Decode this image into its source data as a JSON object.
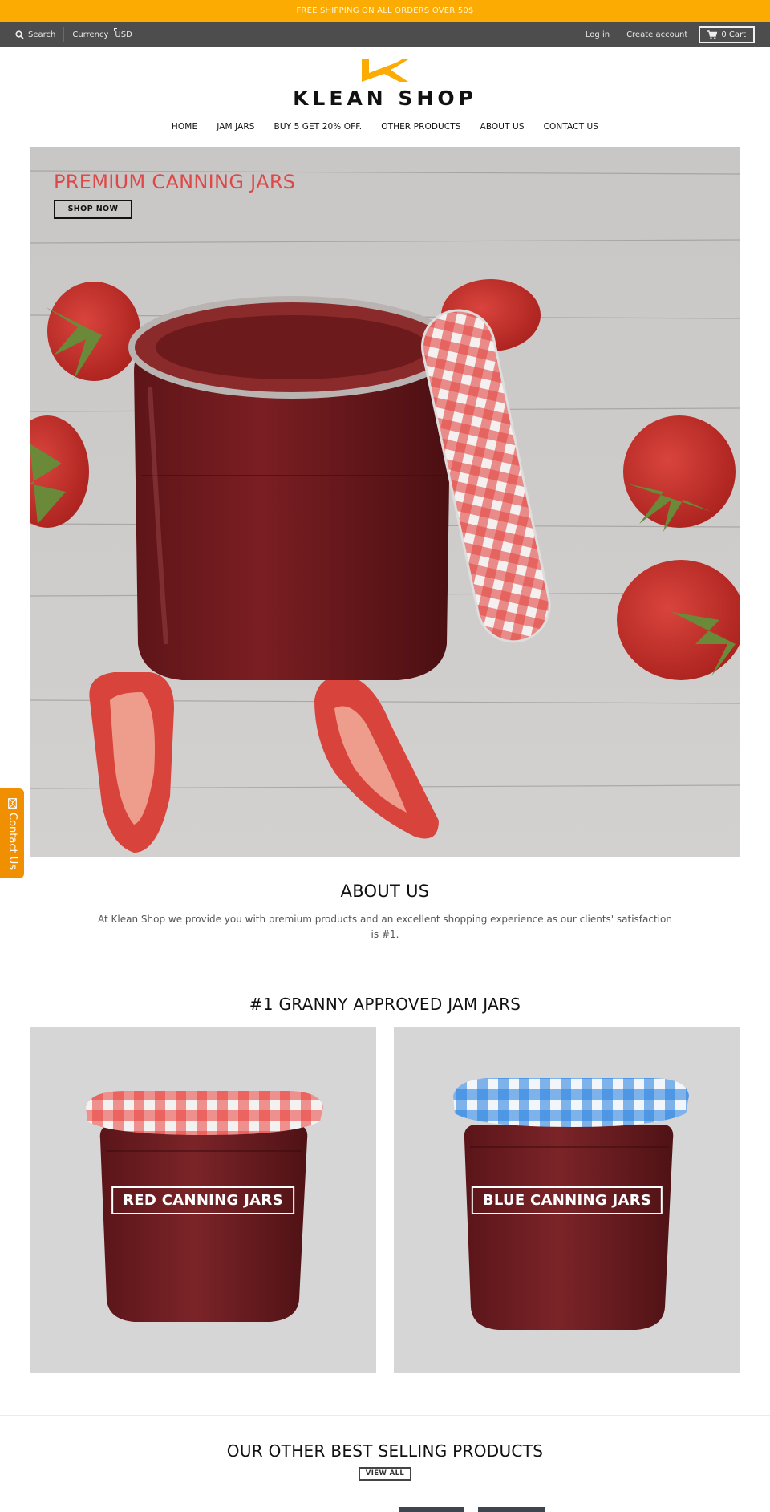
{
  "announcement": {
    "text": "FREE SHIPPING ON ALL ORDERS OVER 50$"
  },
  "topbar": {
    "search_label": "Search",
    "currency_label": "Currency",
    "currency_value": "USD",
    "login_label": "Log in",
    "create_account_label": "Create account",
    "cart_label": "0 Cart"
  },
  "header": {
    "logo_text": "KLEAN SHOP",
    "brand_color": "#fcab03"
  },
  "nav": {
    "items": [
      {
        "label": "HOME"
      },
      {
        "label": "JAM JARS"
      },
      {
        "label": "BUY 5 GET 20% OFF."
      },
      {
        "label": "OTHER PRODUCTS"
      },
      {
        "label": "ABOUT US"
      },
      {
        "label": "CONTACT US"
      }
    ]
  },
  "hero": {
    "title": "PREMIUM CANNING JARS",
    "title_color": "#de4848",
    "button_label": "SHOP NOW"
  },
  "contact_tab": {
    "label": "Contact Us"
  },
  "about": {
    "heading": "ABOUT US",
    "text": "At Klean Shop we provide you with premium products and an excellent shopping experience as our clients' satisfaction is #1."
  },
  "collections": {
    "heading": "#1 GRANNY APPROVED JAM JARS",
    "items": [
      {
        "label": "RED CANNING JARS",
        "lid_color": "#e8403a"
      },
      {
        "label": "BLUE CANNING JARS",
        "lid_color": "#2f86e0"
      }
    ]
  },
  "best_sellers": {
    "heading": "OUR OTHER BEST SELLING PRODUCTS",
    "button_label": "VIEW ALL"
  }
}
